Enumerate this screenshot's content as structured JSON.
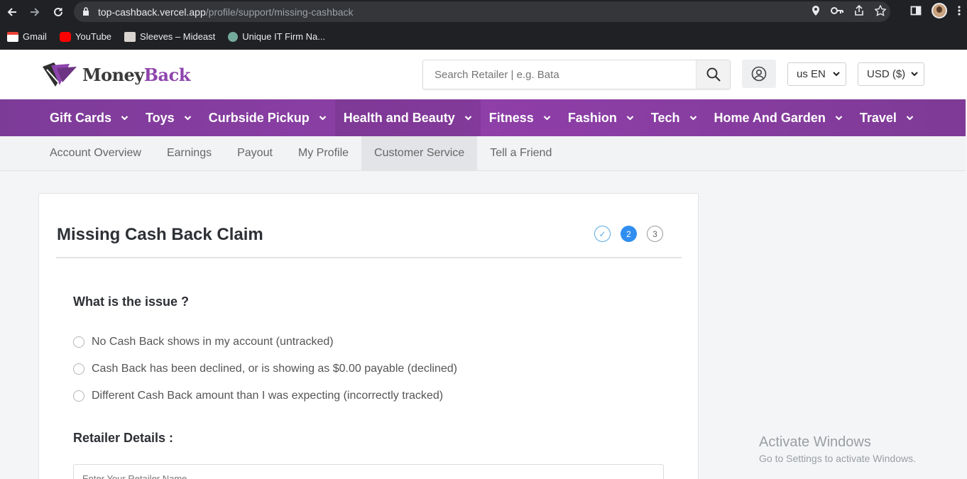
{
  "browser": {
    "url_host": "top-cashback.vercel.app",
    "url_path": "/profile/support/missing-cashback",
    "bookmarks": [
      {
        "label": "Gmail",
        "color": "#ea4335"
      },
      {
        "label": "YouTube",
        "color": "#ff0000"
      },
      {
        "label": "Sleeves – Mideast",
        "color": "#d9d4cf"
      },
      {
        "label": "Unique IT Firm Na...",
        "color": "#74aa9c"
      }
    ]
  },
  "header": {
    "logo_money": "Money",
    "logo_back": "Back",
    "search_placeholder": "Search Retailer | e.g. Bata",
    "language": "us EN",
    "currency": "USD ($)"
  },
  "main_nav": {
    "items": [
      "Gift Cards",
      "Toys",
      "Curbside Pickup",
      "Health and Beauty",
      "Fitness",
      "Fashion",
      "Tech",
      "Home And Garden",
      "Travel"
    ],
    "active_index": 3,
    "color": "#8e3fa8"
  },
  "sub_nav": {
    "items": [
      "Account Overview",
      "Earnings",
      "Payout",
      "My Profile",
      "Customer Service",
      "Tell a Friend"
    ],
    "active_index": 4
  },
  "form": {
    "title": "Missing Cash Back Claim",
    "steps": [
      "✓",
      "2",
      "3"
    ],
    "issue_heading": "What is the issue ?",
    "options": [
      "No Cash Back shows in my account (untracked)",
      "Cash Back has been declined, or is showing as $0.00 payable (declined)",
      "Different Cash Back amount than I was expecting (incorrectly tracked)"
    ],
    "retailer_heading": "Retailer Details :",
    "retailer_placeholder": "Enter Your Retailer Name"
  },
  "watermark": {
    "line1": "Activate Windows",
    "line2": "Go to Settings to activate Windows."
  }
}
